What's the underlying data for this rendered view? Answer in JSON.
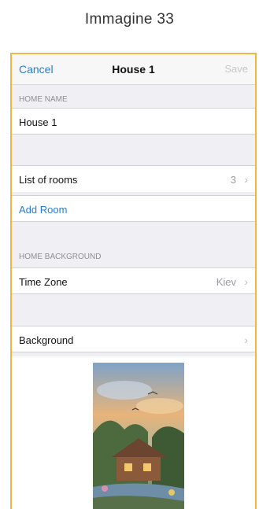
{
  "caption": "Immagine 33",
  "nav": {
    "cancel": "Cancel",
    "title": "House 1",
    "save": "Save"
  },
  "home_name": {
    "header": "HOME NAME",
    "value": "House 1"
  },
  "rooms": {
    "label": "List of rooms",
    "count": "3",
    "add": "Add Room"
  },
  "background_section": {
    "header": "HOME BACKGROUND"
  },
  "time_zone": {
    "label": "Time Zone",
    "value": "Kiev"
  },
  "background": {
    "label": "Background"
  },
  "icons": {
    "chevron": "chevron-right-icon"
  },
  "colors": {
    "accent": "#2a7ccf",
    "frame": "#f3b53f"
  }
}
